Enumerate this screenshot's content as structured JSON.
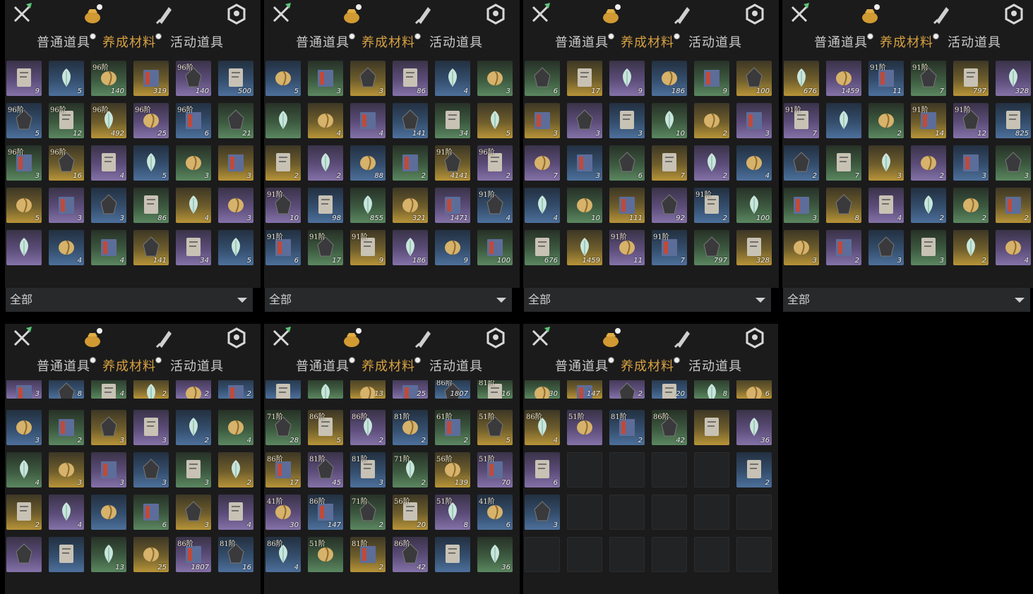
{
  "tabs": [
    "普通道具",
    "养成材料",
    "活动道具"
  ],
  "active_tab": "养成材料",
  "icons": [
    "crossed-swords-icon",
    "gold-pouch-icon",
    "scroll-brush-icon",
    "token-icon"
  ],
  "filter_label": "全部",
  "panels": [
    {
      "rows": [
        [
          "9",
          "5",
          "140|96阶",
          "319",
          "140|96阶",
          "500"
        ],
        [
          "5|96阶",
          "12|96阶",
          "492|96阶",
          "25|96阶",
          "6|96阶",
          "21"
        ],
        [
          "3|96阶",
          "16|96阶",
          "4",
          "5",
          "3",
          "3"
        ],
        [
          "5",
          "3",
          "3",
          "86",
          "4",
          "3"
        ],
        [
          "",
          "4",
          "4",
          "141",
          "34",
          "5"
        ]
      ]
    },
    {
      "rows": [
        [
          "5",
          "3",
          "3",
          "86",
          "4",
          "3"
        ],
        [
          "",
          "4",
          "4",
          "141",
          "34",
          "5"
        ],
        [
          "2",
          "2",
          "88",
          "2",
          "4141|91阶",
          "2|96阶"
        ],
        [
          "10|91阶",
          "98",
          "855",
          "321",
          "1471",
          "4|91阶"
        ],
        [
          "6|91阶",
          "17|91阶",
          "9|91阶",
          "186",
          "9",
          "100"
        ]
      ]
    },
    {
      "rows": [
        [
          "6",
          "17",
          "9",
          "186",
          "9",
          "100"
        ],
        [
          "3",
          "3",
          "3",
          "10",
          "2",
          "3"
        ],
        [
          "7",
          "3",
          "6",
          "7",
          "2",
          "4"
        ],
        [
          "4",
          "10",
          "111",
          "92",
          "2|91阶",
          "100"
        ],
        [
          "676",
          "1459",
          "11|91阶",
          "7|91阶",
          "797",
          "328"
        ]
      ]
    },
    {
      "rows": [
        [
          "676",
          "1459",
          "11|91阶",
          "7|91阶",
          "797",
          "328"
        ],
        [
          "7|91阶",
          "",
          "2",
          "14|91阶",
          "12|91阶",
          "825"
        ],
        [
          "2",
          "7",
          "3",
          "2",
          "3",
          "3"
        ],
        [
          "3",
          "8",
          "4",
          "2",
          "2",
          "2"
        ],
        [
          "3",
          "2",
          "3",
          "3",
          "2",
          "4"
        ]
      ]
    },
    {
      "rows": [
        [
          "3",
          "8",
          "4",
          "2",
          "2",
          "2"
        ],
        [
          "3",
          "2",
          "3",
          "3",
          "2",
          "4"
        ],
        [
          "4",
          "3",
          "3",
          "3",
          "3",
          "2"
        ],
        [
          "2",
          "4",
          "",
          "6",
          "3",
          "4"
        ],
        [
          "",
          "",
          "13",
          "25",
          "1807|86阶",
          "16|81阶"
        ]
      ]
    },
    {
      "rows": [
        [
          "",
          "",
          "13",
          "25",
          "1807|86阶",
          "16|81阶"
        ],
        [
          "28|71阶",
          "5|86阶",
          "2|86阶",
          "2|81阶",
          "2|61阶",
          "5|51阶"
        ],
        [
          "17|86阶",
          "45|81阶",
          "3|81阶",
          "2|71阶",
          "139|56阶",
          "70|51阶"
        ],
        [
          "30|41阶",
          "147|86阶",
          "2|71阶",
          "20|56阶",
          "8|51阶",
          "6|41阶"
        ],
        [
          "4|86阶",
          "|51阶",
          "2|81阶",
          "42|86阶",
          "",
          "36"
        ]
      ]
    },
    {
      "rows": [
        [
          "30",
          "147",
          "2",
          "20",
          "8",
          "6"
        ],
        [
          "4|86阶",
          "|51阶",
          "2|81阶",
          "42|86阶",
          "",
          "36"
        ],
        [
          "6",
          "",
          "",
          "",
          "",
          "2"
        ],
        [
          "3",
          "",
          "",
          "",
          "",
          ""
        ],
        [
          "",
          "",
          "",
          "",
          "",
          ""
        ]
      ]
    }
  ]
}
